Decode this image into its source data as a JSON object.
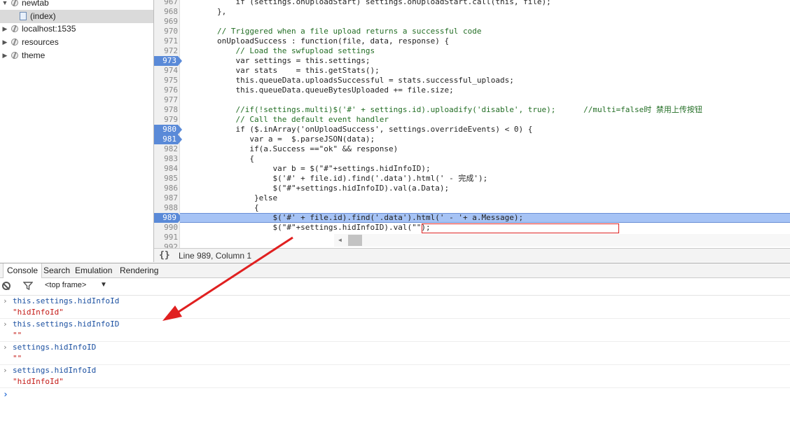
{
  "sources_tree": [
    {
      "label": "newtab",
      "expanded": true,
      "icon": "globe-icon"
    },
    {
      "label": "(index)",
      "selected": true,
      "icon": "document-icon"
    },
    {
      "label": "localhost:1535",
      "expanded": false,
      "icon": "globe-icon"
    },
    {
      "label": "resources",
      "expanded": false,
      "icon": "globe-icon"
    },
    {
      "label": "theme",
      "expanded": false,
      "icon": "globe-icon"
    }
  ],
  "editor": {
    "lines": [
      {
        "n": "967",
        "code": "            if (settings.onUploadStart) settings.onUploadStart.call(this, file);"
      },
      {
        "n": "968",
        "code": "        },"
      },
      {
        "n": "969",
        "code": ""
      },
      {
        "n": "970",
        "code": "        // Triggered when a file upload returns a successful code",
        "comment": true
      },
      {
        "n": "971",
        "code": "        onUploadSuccess : function(file, data, response) {"
      },
      {
        "n": "972",
        "code": "            // Load the swfupload settings",
        "comment": true
      },
      {
        "n": "973",
        "code": "            var settings = this.settings;",
        "bp": true
      },
      {
        "n": "974",
        "code": "            var stats    = this.getStats();"
      },
      {
        "n": "975",
        "code": "            this.queueData.uploadsSuccessful = stats.successful_uploads;"
      },
      {
        "n": "976",
        "code": "            this.queueData.queueBytesUploaded += file.size;"
      },
      {
        "n": "977",
        "code": ""
      },
      {
        "n": "978",
        "code": "            //if(!settings.multi)$('#' + settings.id).uploadify('disable', true);      //multi=false时 禁用上传按钮",
        "comment": true
      },
      {
        "n": "979",
        "code": "            // Call the default event handler",
        "comment": true
      },
      {
        "n": "980",
        "code": "            if ($.inArray('onUploadSuccess', settings.overrideEvents) < 0) {",
        "bp": true
      },
      {
        "n": "981",
        "code": "               var a =  $.parseJSON(data);",
        "bp": true
      },
      {
        "n": "982",
        "code": "               if(a.Success ==\"ok\" && response)"
      },
      {
        "n": "983",
        "code": "               {"
      },
      {
        "n": "984",
        "code": "                    var b = $(\"#\"+settings.hidInfoID);"
      },
      {
        "n": "985",
        "code": "                    $('#' + file.id).find('.data').html(' - 完成');"
      },
      {
        "n": "986",
        "code": "                    $(\"#\"+settings.hidInfoID).val(a.Data);"
      },
      {
        "n": "987",
        "code": "                }else"
      },
      {
        "n": "988",
        "code": "                {"
      },
      {
        "n": "989",
        "code": "                    $('#' + file.id).find('.data').html(' - '+ a.Message);",
        "bp": true,
        "current": true
      },
      {
        "n": "990",
        "code": "                    $(\"#\"+settings.hidInfoID).val(\"\");"
      },
      {
        "n": "991",
        "code": ""
      },
      {
        "n": "992",
        "code": ""
      }
    ],
    "status": "Line 989, Column 1",
    "pretty_print_label": "{}"
  },
  "drawer_tabs": [
    "Console",
    "Search",
    "Emulation",
    "Rendering"
  ],
  "console_toolbar": {
    "frame": "<top frame>"
  },
  "console": [
    {
      "cmd": "this.settings.hidInfoId",
      "result": "\"hidInfoId\""
    },
    {
      "cmd": "this.settings.hidInfoID",
      "result": "\"\""
    },
    {
      "cmd": "settings.hidInfoID",
      "result": "\"\""
    },
    {
      "cmd": "settings.hidInfoId",
      "result": "\"hidInfoId\""
    }
  ],
  "colors": {
    "breakpoint": "#5a8ad8",
    "current_line": "#a6c3f5",
    "annotation": "#e02020",
    "prompt": "#2b6fd6"
  }
}
